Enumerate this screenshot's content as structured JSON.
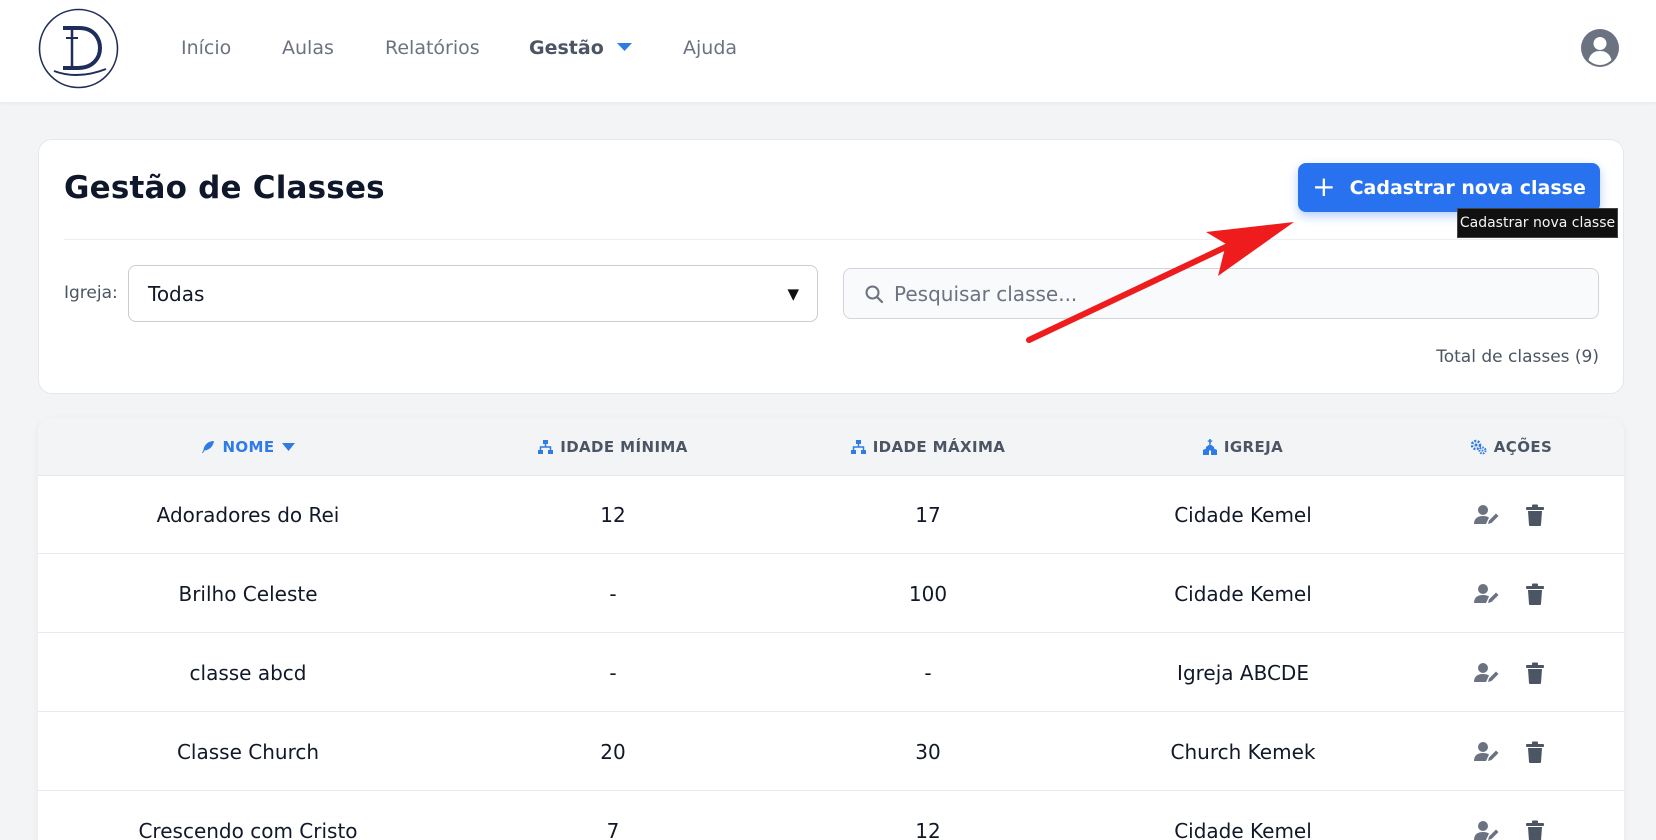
{
  "nav": {
    "items": [
      {
        "label": "Início"
      },
      {
        "label": "Aulas"
      },
      {
        "label": "Relatórios"
      },
      {
        "label": "Gestão"
      },
      {
        "label": "Ajuda"
      }
    ]
  },
  "colors": {
    "primary": "#2872f0",
    "annotation_arrow": "#ee1c1c",
    "sorted_header": "#2f7be8"
  },
  "page": {
    "title": "Gestão de Classes",
    "add_button_label": "Cadastrar nova classe",
    "tooltip": "Cadastrar nova classe",
    "filter": {
      "label": "Igreja:",
      "selected": "Todas"
    },
    "search": {
      "placeholder": "Pesquisar classe..."
    },
    "total_label": "Total de classes (9)"
  },
  "table": {
    "headers": {
      "name": "NOME",
      "min_age": "IDADE MÍNIMA",
      "max_age": "IDADE MÁXIMA",
      "church": "IGREJA",
      "actions": "AÇÕES"
    },
    "rows": [
      {
        "name": "Adoradores do Rei",
        "min_age": "12",
        "max_age": "17",
        "church": "Cidade Kemel"
      },
      {
        "name": "Brilho Celeste",
        "min_age": "-",
        "max_age": "100",
        "church": "Cidade Kemel"
      },
      {
        "name": "classe abcd",
        "min_age": "-",
        "max_age": "-",
        "church": "Igreja ABCDE"
      },
      {
        "name": "Classe Church",
        "min_age": "20",
        "max_age": "30",
        "church": "Church Kemek"
      },
      {
        "name": "Crescendo com Cristo",
        "min_age": "7",
        "max_age": "12",
        "church": "Cidade Kemel"
      }
    ]
  }
}
